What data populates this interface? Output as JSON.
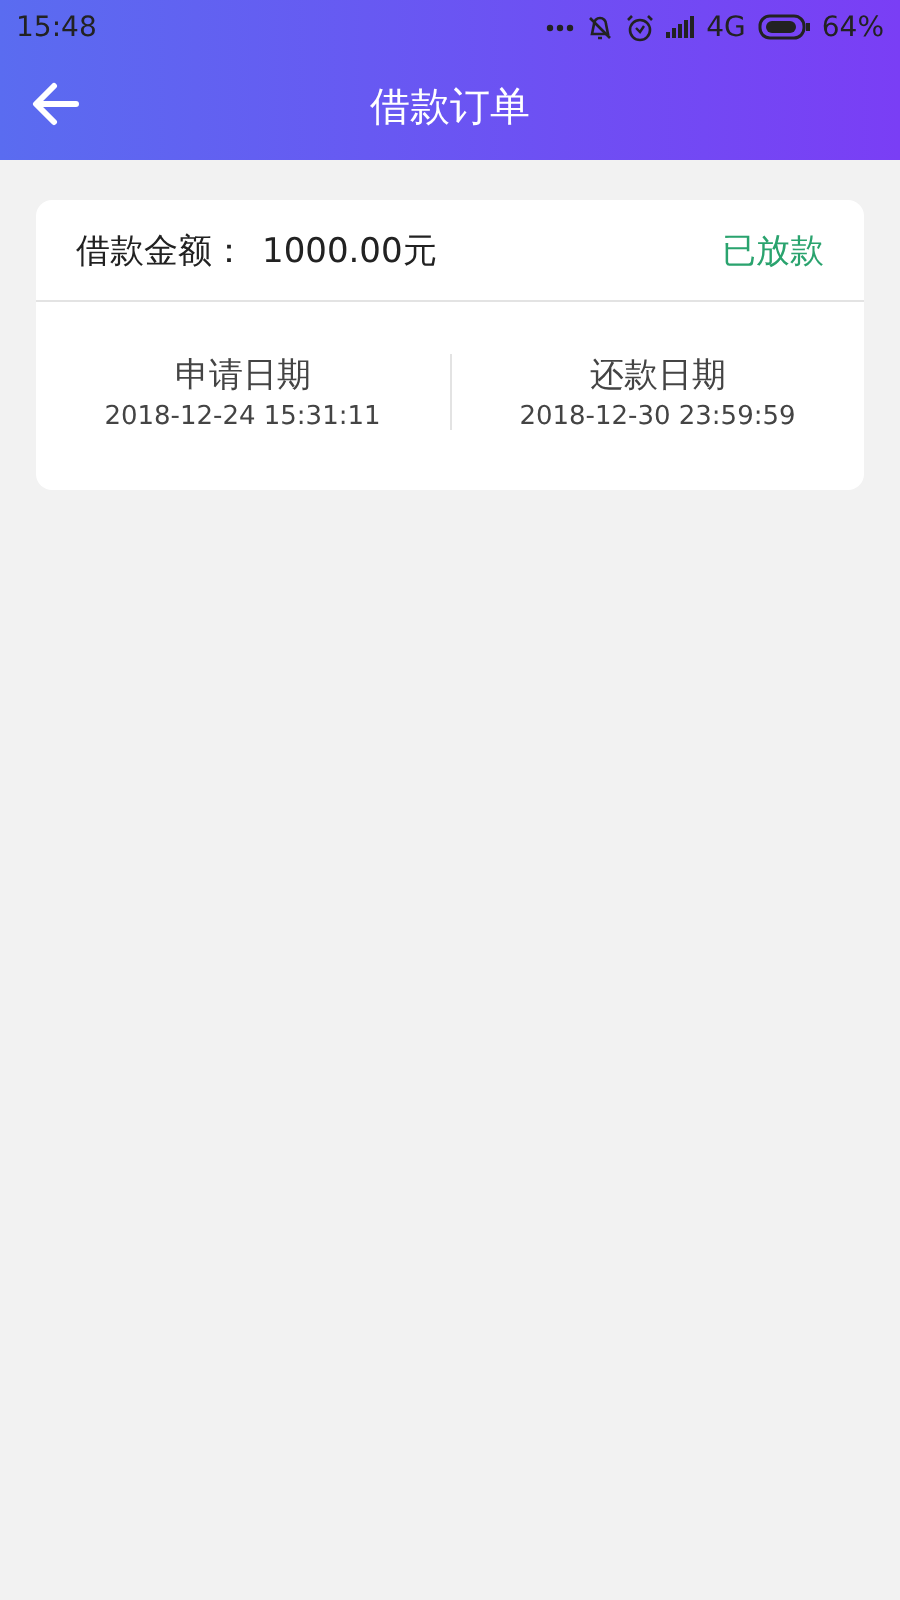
{
  "status_bar": {
    "time": "15:48",
    "network": "4G",
    "battery": "64%"
  },
  "header": {
    "title": "借款订单"
  },
  "order": {
    "amount_label": "借款金额：",
    "amount": "1000.00元",
    "status": "已放款",
    "dates": [
      {
        "label": "申请日期",
        "value": "2018-12-24 15:31:11"
      },
      {
        "label": "还款日期",
        "value": "2018-12-30 23:59:59"
      }
    ]
  }
}
